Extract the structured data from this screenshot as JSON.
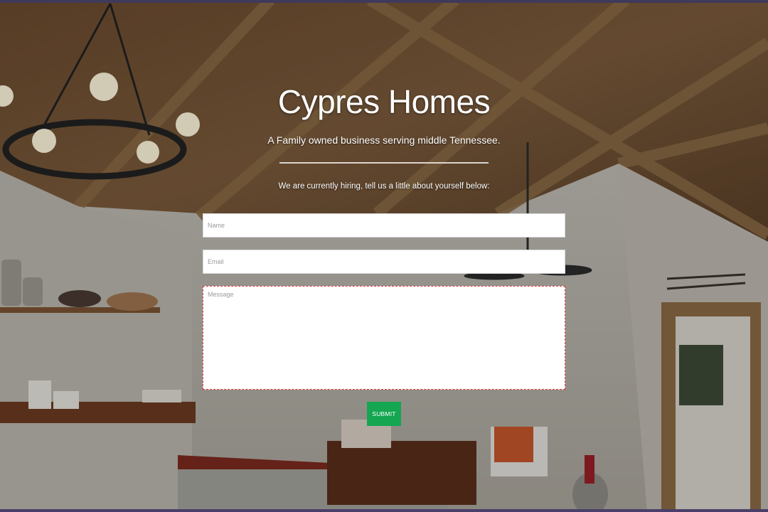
{
  "hero": {
    "title": "Cypres Homes",
    "tagline": "A Family owned business serving middle Tennessee.",
    "hiring_text": "We are currently hiring, tell us a little about yourself below:"
  },
  "form": {
    "name_placeholder": "Name",
    "email_placeholder": "Email",
    "message_placeholder": "Message",
    "submit_label": "SUBMIT"
  },
  "colors": {
    "submit_bg": "#14a651",
    "top_bar": "#3f3a5c",
    "bottom_bar": "#4a3f6a"
  },
  "background": {
    "icons": [
      "chandelier-icon",
      "ceiling-fan-icon",
      "wall-arrows-icon"
    ]
  }
}
